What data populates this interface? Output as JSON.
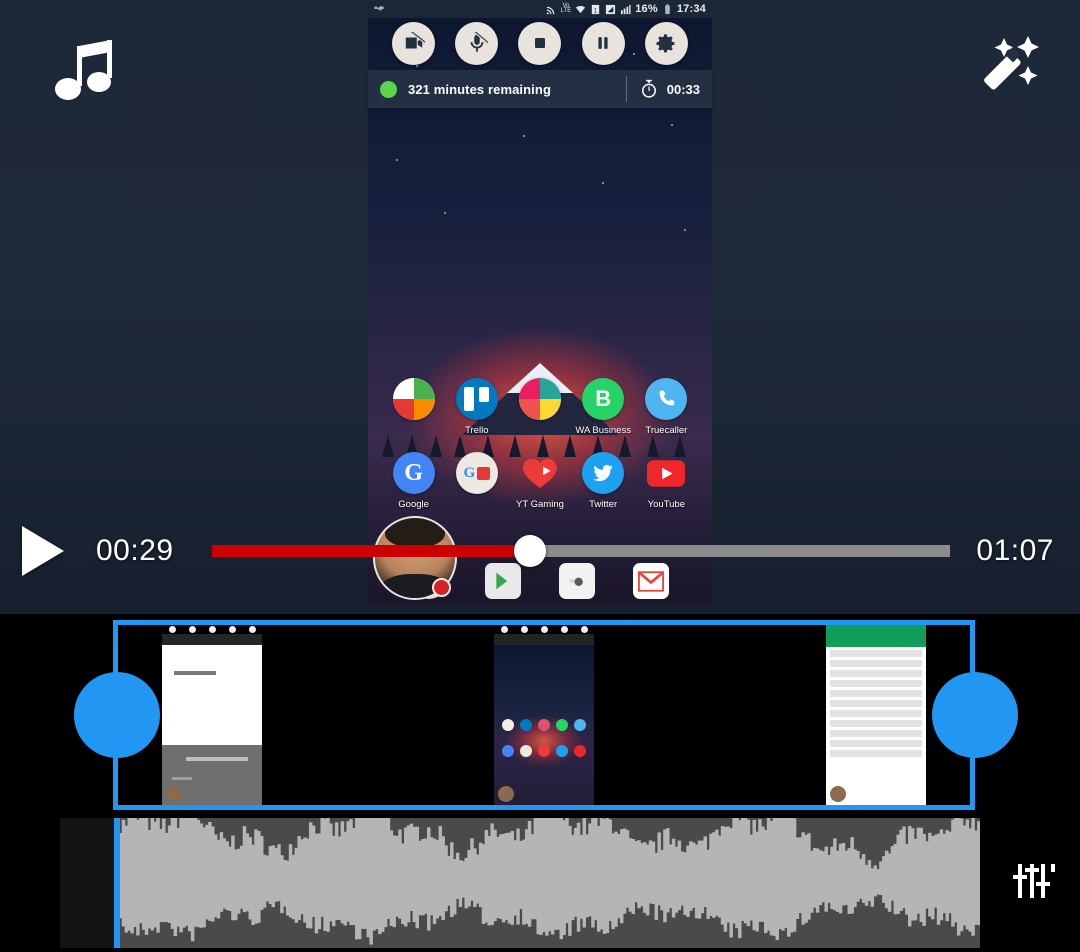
{
  "app": {
    "left_corner_icon": "music-note-icon",
    "right_corner_icon": "magic-wand-icon",
    "bottom_right_icon": "equalizer-icon"
  },
  "player": {
    "play_button": "play-icon",
    "current_time": "00:29",
    "total_time": "01:07",
    "progress_percent": 41,
    "progress_fill_color": "#cc0000",
    "progress_track_color": "#8c8c8c",
    "handle_color": "#ffffff"
  },
  "captured_screen": {
    "statusbar": {
      "time": "17:34",
      "battery": "16%",
      "icons": [
        "cast-icon",
        "volte-icon",
        "wifi-icon",
        "sim-icon",
        "signal-1-icon",
        "signal-2-icon",
        "battery-icon"
      ]
    },
    "recorder_controls": [
      {
        "name": "camera-off-button",
        "icon": "camera-off-icon"
      },
      {
        "name": "mic-off-button",
        "icon": "mic-off-icon"
      },
      {
        "name": "stop-button",
        "icon": "stop-square-icon"
      },
      {
        "name": "pause-button",
        "icon": "pause-icon"
      },
      {
        "name": "settings-button",
        "icon": "gear-icon"
      }
    ],
    "status_strip": {
      "dot_color": "#5cd44a",
      "remaining_label": "321 minutes remaining",
      "timer_icon": "stopwatch-icon",
      "elapsed": "00:33"
    },
    "home_rows": [
      [
        {
          "label": "",
          "type": "folder",
          "colors": [
            "#ffffff",
            "#4caf50",
            "#e53935",
            "#fb8c00"
          ]
        },
        {
          "label": "Trello",
          "type": "trello"
        },
        {
          "label": "",
          "type": "folder",
          "colors": [
            "#e91e63",
            "#26a69a",
            "#ef5350",
            "#fdd835"
          ]
        },
        {
          "label": "WA Business",
          "type": "whatsapp-business"
        },
        {
          "label": "Truecaller",
          "type": "truecaller"
        }
      ],
      [
        {
          "label": "Google",
          "type": "google"
        },
        {
          "label": "",
          "type": "folder",
          "colors": [
            "#ffffff",
            "#e8e8e8",
            "#f4f4f4",
            "#e0e0e0"
          ]
        },
        {
          "label": "YT Gaming",
          "type": "yt-gaming"
        },
        {
          "label": "Twitter",
          "type": "twitter"
        },
        {
          "label": "YouTube",
          "type": "youtube"
        }
      ]
    ],
    "dock": [
      {
        "name": "app-drawer-icon"
      },
      {
        "name": "play-store-icon"
      },
      {
        "name": "camera-icon"
      },
      {
        "name": "gmail-icon"
      }
    ],
    "facecam": {
      "name": "facecam-bubble",
      "rec_color": "#d62222"
    }
  },
  "timeline": {
    "selection_color": "#2196f3",
    "left_handle": "trim-handle-left",
    "right_handle": "trim-handle-right",
    "thumbnails": [
      {
        "name": "thumbnail-document"
      },
      {
        "name": "thumbnail-home-screen"
      },
      {
        "name": "thumbnail-app-list"
      }
    ],
    "waveform": {
      "playhead_color": "#2196f3",
      "wave_color": "#b5b5b5",
      "background_color": "#4a4a4a"
    }
  }
}
